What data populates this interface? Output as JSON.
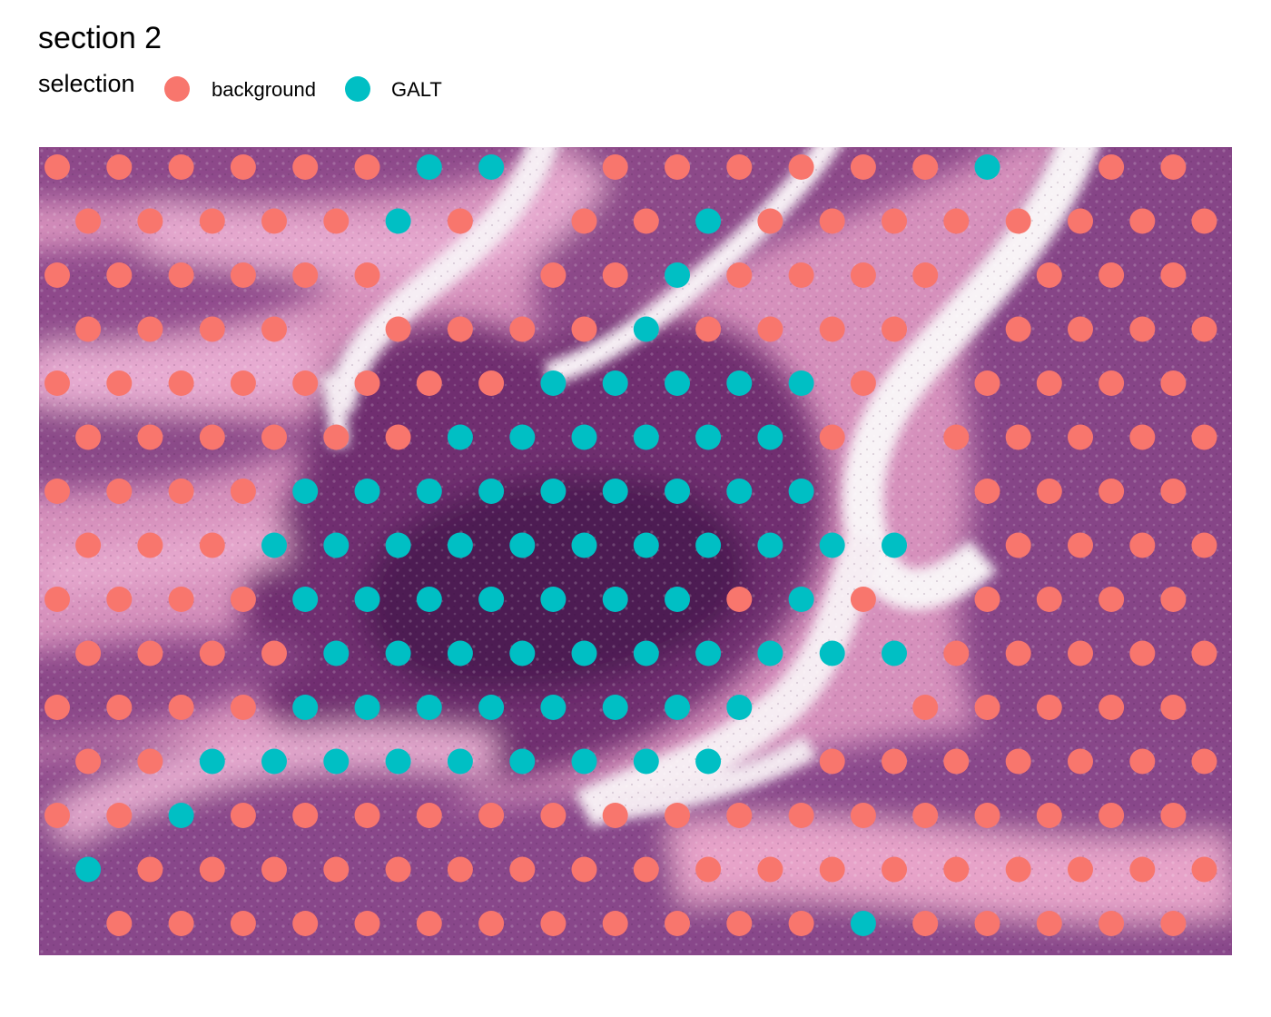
{
  "chart_data": {
    "type": "scatter",
    "title": "section 2",
    "legend": {
      "title": "selection",
      "placement": "top-left",
      "entries": [
        {
          "name": "background",
          "color": "#F8766D"
        },
        {
          "name": "GALT",
          "color": "#00BFC4"
        }
      ]
    },
    "background_image": "H&E stained tissue section",
    "grid": false,
    "axes_visible": false,
    "spot_grid": {
      "columns_per_row": 20,
      "rows": 15,
      "odd_rows_offset_half_column": true
    },
    "series": [
      {
        "name": "background",
        "color": "#F8766D",
        "spots": [
          [
            0,
            0
          ],
          [
            0,
            1
          ],
          [
            0,
            2
          ],
          [
            0,
            3
          ],
          [
            0,
            4
          ],
          [
            0,
            5
          ],
          [
            0,
            9
          ],
          [
            0,
            10
          ],
          [
            0,
            11
          ],
          [
            0,
            12
          ],
          [
            0,
            13
          ],
          [
            0,
            14
          ],
          [
            0,
            17
          ],
          [
            0,
            18
          ],
          [
            1,
            0
          ],
          [
            1,
            1
          ],
          [
            1,
            2
          ],
          [
            1,
            3
          ],
          [
            1,
            4
          ],
          [
            1,
            6
          ],
          [
            1,
            8
          ],
          [
            1,
            9
          ],
          [
            1,
            11
          ],
          [
            1,
            12
          ],
          [
            1,
            13
          ],
          [
            1,
            14
          ],
          [
            1,
            15
          ],
          [
            1,
            16
          ],
          [
            1,
            17
          ],
          [
            1,
            18
          ],
          [
            2,
            0
          ],
          [
            2,
            1
          ],
          [
            2,
            2
          ],
          [
            2,
            3
          ],
          [
            2,
            4
          ],
          [
            2,
            5
          ],
          [
            2,
            8
          ],
          [
            2,
            9
          ],
          [
            2,
            11
          ],
          [
            2,
            12
          ],
          [
            2,
            13
          ],
          [
            2,
            14
          ],
          [
            2,
            16
          ],
          [
            2,
            17
          ],
          [
            2,
            18
          ],
          [
            3,
            0
          ],
          [
            3,
            1
          ],
          [
            3,
            2
          ],
          [
            3,
            3
          ],
          [
            3,
            5
          ],
          [
            3,
            6
          ],
          [
            3,
            7
          ],
          [
            3,
            8
          ],
          [
            3,
            10
          ],
          [
            3,
            11
          ],
          [
            3,
            12
          ],
          [
            3,
            13
          ],
          [
            3,
            15
          ],
          [
            3,
            16
          ],
          [
            3,
            17
          ],
          [
            3,
            18
          ],
          [
            4,
            0
          ],
          [
            4,
            1
          ],
          [
            4,
            2
          ],
          [
            4,
            3
          ],
          [
            4,
            4
          ],
          [
            4,
            5
          ],
          [
            4,
            6
          ],
          [
            4,
            7
          ],
          [
            4,
            13
          ],
          [
            4,
            15
          ],
          [
            4,
            16
          ],
          [
            4,
            17
          ],
          [
            4,
            18
          ],
          [
            5,
            0
          ],
          [
            5,
            1
          ],
          [
            5,
            2
          ],
          [
            5,
            3
          ],
          [
            5,
            4
          ],
          [
            5,
            5
          ],
          [
            5,
            12
          ],
          [
            5,
            14
          ],
          [
            5,
            15
          ],
          [
            5,
            16
          ],
          [
            5,
            17
          ],
          [
            5,
            18
          ],
          [
            6,
            0
          ],
          [
            6,
            1
          ],
          [
            6,
            2
          ],
          [
            6,
            3
          ],
          [
            6,
            15
          ],
          [
            6,
            16
          ],
          [
            6,
            17
          ],
          [
            6,
            18
          ],
          [
            7,
            0
          ],
          [
            7,
            1
          ],
          [
            7,
            2
          ],
          [
            7,
            15
          ],
          [
            7,
            16
          ],
          [
            7,
            17
          ],
          [
            7,
            18
          ],
          [
            8,
            0
          ],
          [
            8,
            1
          ],
          [
            8,
            2
          ],
          [
            8,
            3
          ],
          [
            8,
            11
          ],
          [
            8,
            13
          ],
          [
            8,
            15
          ],
          [
            8,
            16
          ],
          [
            8,
            17
          ],
          [
            8,
            18
          ],
          [
            9,
            0
          ],
          [
            9,
            1
          ],
          [
            9,
            2
          ],
          [
            9,
            3
          ],
          [
            9,
            14
          ],
          [
            9,
            15
          ],
          [
            9,
            16
          ],
          [
            9,
            17
          ],
          [
            9,
            18
          ],
          [
            10,
            0
          ],
          [
            10,
            1
          ],
          [
            10,
            2
          ],
          [
            10,
            3
          ],
          [
            10,
            14
          ],
          [
            10,
            15
          ],
          [
            10,
            16
          ],
          [
            10,
            17
          ],
          [
            10,
            18
          ],
          [
            11,
            0
          ],
          [
            11,
            1
          ],
          [
            11,
            12
          ],
          [
            11,
            13
          ],
          [
            11,
            14
          ],
          [
            11,
            15
          ],
          [
            11,
            16
          ],
          [
            11,
            17
          ],
          [
            11,
            18
          ],
          [
            12,
            0
          ],
          [
            12,
            1
          ],
          [
            12,
            3
          ],
          [
            12,
            4
          ],
          [
            12,
            5
          ],
          [
            12,
            6
          ],
          [
            12,
            7
          ],
          [
            12,
            8
          ],
          [
            12,
            9
          ],
          [
            12,
            10
          ],
          [
            12,
            11
          ],
          [
            12,
            12
          ],
          [
            12,
            13
          ],
          [
            12,
            14
          ],
          [
            12,
            15
          ],
          [
            12,
            16
          ],
          [
            12,
            17
          ],
          [
            12,
            18
          ],
          [
            13,
            1
          ],
          [
            13,
            2
          ],
          [
            13,
            3
          ],
          [
            13,
            4
          ],
          [
            13,
            5
          ],
          [
            13,
            6
          ],
          [
            13,
            7
          ],
          [
            13,
            8
          ],
          [
            13,
            9
          ],
          [
            13,
            10
          ],
          [
            13,
            11
          ],
          [
            13,
            12
          ],
          [
            13,
            13
          ],
          [
            13,
            14
          ],
          [
            13,
            15
          ],
          [
            13,
            16
          ],
          [
            13,
            17
          ],
          [
            13,
            18
          ],
          [
            14,
            1
          ],
          [
            14,
            2
          ],
          [
            14,
            3
          ],
          [
            14,
            4
          ],
          [
            14,
            5
          ],
          [
            14,
            6
          ],
          [
            14,
            7
          ],
          [
            14,
            8
          ],
          [
            14,
            9
          ],
          [
            14,
            10
          ],
          [
            14,
            11
          ],
          [
            14,
            12
          ],
          [
            14,
            14
          ],
          [
            14,
            15
          ],
          [
            14,
            16
          ],
          [
            14,
            17
          ],
          [
            14,
            18
          ]
        ]
      },
      {
        "name": "GALT",
        "color": "#00BFC4",
        "spots": [
          [
            0,
            6
          ],
          [
            0,
            7
          ],
          [
            0,
            15
          ],
          [
            1,
            5
          ],
          [
            1,
            10
          ],
          [
            2,
            10
          ],
          [
            3,
            9
          ],
          [
            4,
            8
          ],
          [
            4,
            9
          ],
          [
            4,
            10
          ],
          [
            4,
            11
          ],
          [
            4,
            12
          ],
          [
            5,
            6
          ],
          [
            5,
            7
          ],
          [
            5,
            8
          ],
          [
            5,
            9
          ],
          [
            5,
            10
          ],
          [
            5,
            11
          ],
          [
            6,
            4
          ],
          [
            6,
            5
          ],
          [
            6,
            6
          ],
          [
            6,
            7
          ],
          [
            6,
            8
          ],
          [
            6,
            9
          ],
          [
            6,
            10
          ],
          [
            6,
            11
          ],
          [
            6,
            12
          ],
          [
            7,
            3
          ],
          [
            7,
            4
          ],
          [
            7,
            5
          ],
          [
            7,
            6
          ],
          [
            7,
            7
          ],
          [
            7,
            8
          ],
          [
            7,
            9
          ],
          [
            7,
            10
          ],
          [
            7,
            11
          ],
          [
            7,
            12
          ],
          [
            7,
            13
          ],
          [
            8,
            4
          ],
          [
            8,
            5
          ],
          [
            8,
            6
          ],
          [
            8,
            7
          ],
          [
            8,
            8
          ],
          [
            8,
            9
          ],
          [
            8,
            10
          ],
          [
            8,
            12
          ],
          [
            9,
            4
          ],
          [
            9,
            5
          ],
          [
            9,
            6
          ],
          [
            9,
            7
          ],
          [
            9,
            8
          ],
          [
            9,
            9
          ],
          [
            9,
            10
          ],
          [
            9,
            11
          ],
          [
            9,
            12
          ],
          [
            9,
            13
          ],
          [
            10,
            4
          ],
          [
            10,
            5
          ],
          [
            10,
            6
          ],
          [
            10,
            7
          ],
          [
            10,
            8
          ],
          [
            10,
            9
          ],
          [
            10,
            10
          ],
          [
            10,
            11
          ],
          [
            11,
            2
          ],
          [
            11,
            3
          ],
          [
            11,
            4
          ],
          [
            11,
            5
          ],
          [
            11,
            6
          ],
          [
            11,
            7
          ],
          [
            11,
            8
          ],
          [
            11,
            9
          ],
          [
            11,
            10
          ],
          [
            12,
            2
          ],
          [
            13,
            0
          ],
          [
            14,
            13
          ]
        ]
      }
    ]
  }
}
